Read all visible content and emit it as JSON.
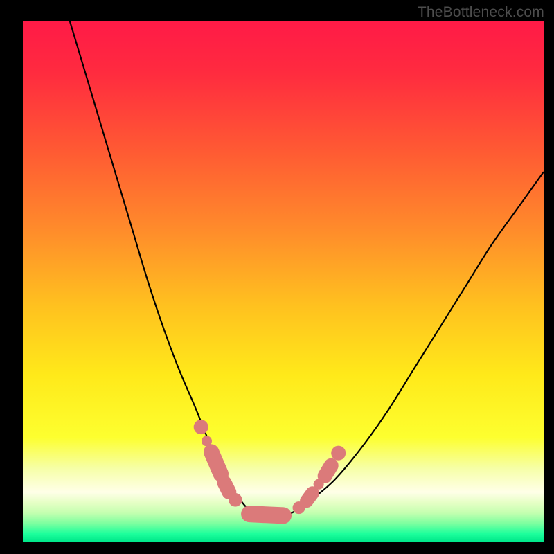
{
  "watermark": "TheBottleneck.com",
  "chart_data": {
    "type": "line",
    "title": "",
    "xlabel": "",
    "ylabel": "",
    "xlim": [
      0,
      100
    ],
    "ylim": [
      0,
      100
    ],
    "grid": false,
    "legend": false,
    "gradient_stops": [
      {
        "offset": 0.0,
        "color": "#ff1a47"
      },
      {
        "offset": 0.1,
        "color": "#ff2b3f"
      },
      {
        "offset": 0.25,
        "color": "#ff5a33"
      },
      {
        "offset": 0.4,
        "color": "#ff8b2b"
      },
      {
        "offset": 0.55,
        "color": "#ffc21f"
      },
      {
        "offset": 0.68,
        "color": "#ffe91a"
      },
      {
        "offset": 0.8,
        "color": "#fdff2f"
      },
      {
        "offset": 0.86,
        "color": "#f6ffa8"
      },
      {
        "offset": 0.905,
        "color": "#ffffe8"
      },
      {
        "offset": 0.925,
        "color": "#e6ffc6"
      },
      {
        "offset": 0.945,
        "color": "#c4ffb0"
      },
      {
        "offset": 0.965,
        "color": "#7effa0"
      },
      {
        "offset": 0.985,
        "color": "#1dff9c"
      },
      {
        "offset": 1.0,
        "color": "#00e88a"
      }
    ],
    "series": [
      {
        "name": "bottleneck-curve",
        "x": [
          9,
          12,
          15,
          18,
          21,
          24,
          27,
          30,
          33,
          35,
          37,
          39,
          41,
          43,
          45,
          47,
          50,
          53,
          56,
          60,
          65,
          70,
          75,
          80,
          85,
          90,
          95,
          100
        ],
        "y": [
          100,
          90,
          80,
          70,
          60,
          50,
          41,
          33,
          26,
          21,
          16,
          12,
          9,
          6.5,
          5,
          5,
          5,
          6.2,
          8.5,
          12,
          18,
          25,
          33,
          41,
          49,
          57,
          64,
          71
        ]
      }
    ],
    "markers": [
      {
        "shape": "circle",
        "cx": 34.2,
        "cy": 22.0,
        "r": 1.4
      },
      {
        "shape": "circle",
        "cx": 35.3,
        "cy": 19.3,
        "r": 1.0
      },
      {
        "shape": "capsule",
        "x1": 36.2,
        "y1": 17.2,
        "x2": 38.0,
        "y2": 13.0,
        "r": 1.5
      },
      {
        "shape": "capsule",
        "x1": 38.7,
        "y1": 11.3,
        "x2": 39.6,
        "y2": 9.5,
        "r": 1.4
      },
      {
        "shape": "circle",
        "cx": 40.8,
        "cy": 8.0,
        "r": 1.3
      },
      {
        "shape": "capsule",
        "x1": 43.5,
        "y1": 5.3,
        "x2": 50.0,
        "y2": 5.0,
        "r": 1.6
      },
      {
        "shape": "circle",
        "cx": 53.0,
        "cy": 6.5,
        "r": 1.2
      },
      {
        "shape": "capsule",
        "x1": 54.5,
        "y1": 7.8,
        "x2": 55.6,
        "y2": 9.3,
        "r": 1.3
      },
      {
        "shape": "circle",
        "cx": 56.8,
        "cy": 11.0,
        "r": 1.0
      },
      {
        "shape": "capsule",
        "x1": 58.0,
        "y1": 12.6,
        "x2": 59.2,
        "y2": 14.6,
        "r": 1.4
      },
      {
        "shape": "circle",
        "cx": 60.6,
        "cy": 17.0,
        "r": 1.4
      }
    ],
    "marker_color": "#db7a7a",
    "curve_color": "#000000",
    "curve_width": 2.2
  }
}
